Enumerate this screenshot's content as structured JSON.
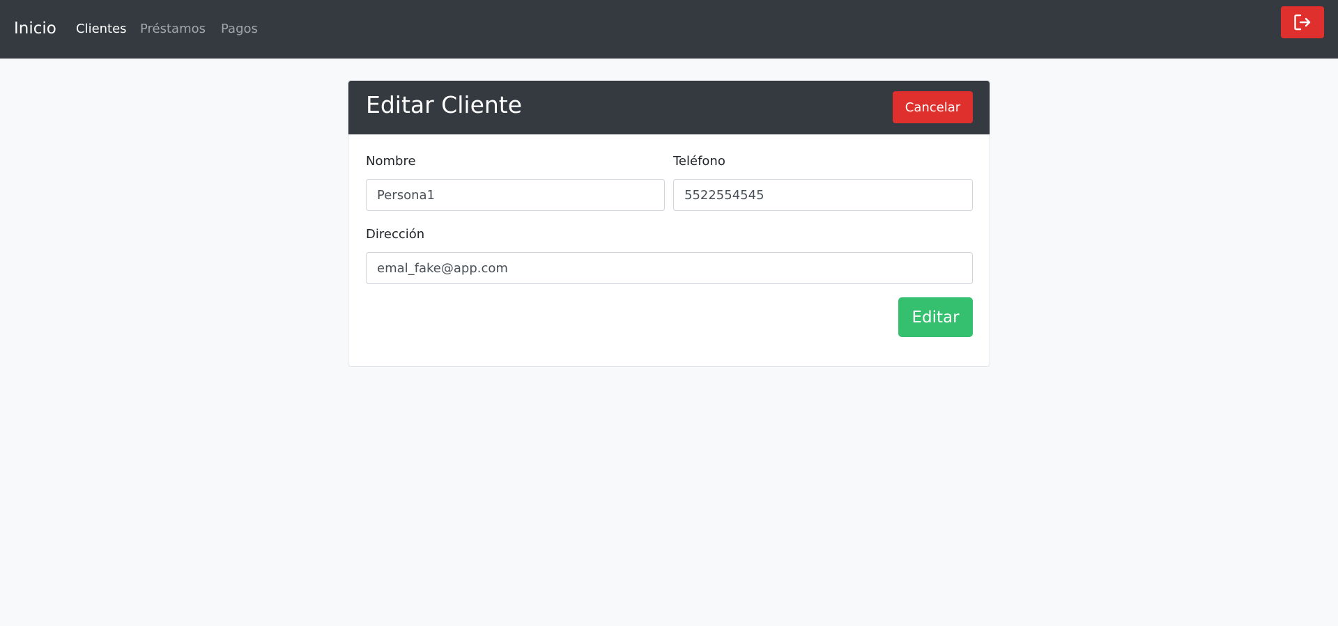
{
  "navbar": {
    "brand": "Inicio",
    "links": [
      {
        "label": "Clientes",
        "active": true
      },
      {
        "label": "Préstamos",
        "active": false
      },
      {
        "label": "Pagos",
        "active": false
      }
    ],
    "logout_icon": "logout-icon"
  },
  "card": {
    "title": "Editar Cliente",
    "cancel_label": "Cancelar",
    "fields": {
      "nombre": {
        "label": "Nombre",
        "value": "Persona1"
      },
      "telefono": {
        "label": "Teléfono",
        "value": "5522554545"
      },
      "direccion": {
        "label": "Dirección",
        "value": "emal_fake@app.com"
      }
    },
    "submit_label": "Editar"
  },
  "colors": {
    "navbar_bg": "#343a40",
    "danger": "#e0302d",
    "success": "#34c06f",
    "page_bg": "#f8f9fa"
  }
}
